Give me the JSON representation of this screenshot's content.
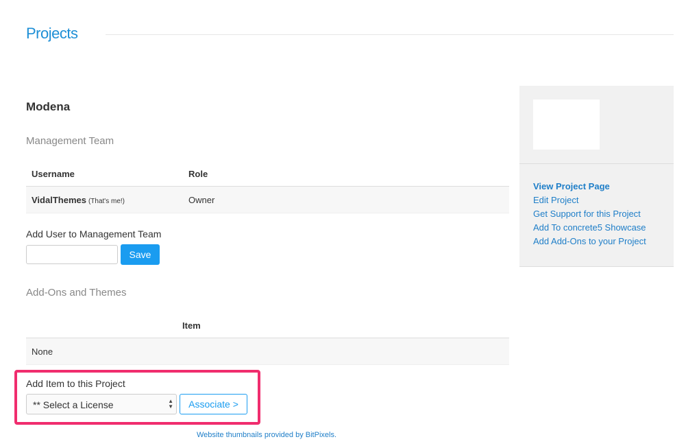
{
  "header": {
    "title": "Projects"
  },
  "project": {
    "name": "Modena"
  },
  "management": {
    "heading": "Management Team",
    "columns": [
      "Username",
      "Role"
    ],
    "rows": [
      {
        "username": "VidalThemes",
        "note": "(That's me!)",
        "role": "Owner"
      }
    ],
    "add_label": "Add User to Management Team",
    "input_value": "",
    "save_label": "Save"
  },
  "addons": {
    "heading": "Add-Ons and Themes",
    "column": "Item",
    "empty_row": "None",
    "add_label": "Add Item to this Project",
    "select_value": "** Select a License",
    "associate_label": "Associate >"
  },
  "footer": {
    "note": "Website thumbnails provided by BitPixels."
  },
  "sidebar": {
    "links": [
      "View Project Page",
      "Edit Project",
      "Get Support for this Project",
      "Add To concrete5 Showcase",
      "Add Add-Ons to your Project"
    ]
  },
  "colors": {
    "accent": "#1a9cf0",
    "link": "#1e7ec8",
    "highlight": "#f02d6e"
  }
}
